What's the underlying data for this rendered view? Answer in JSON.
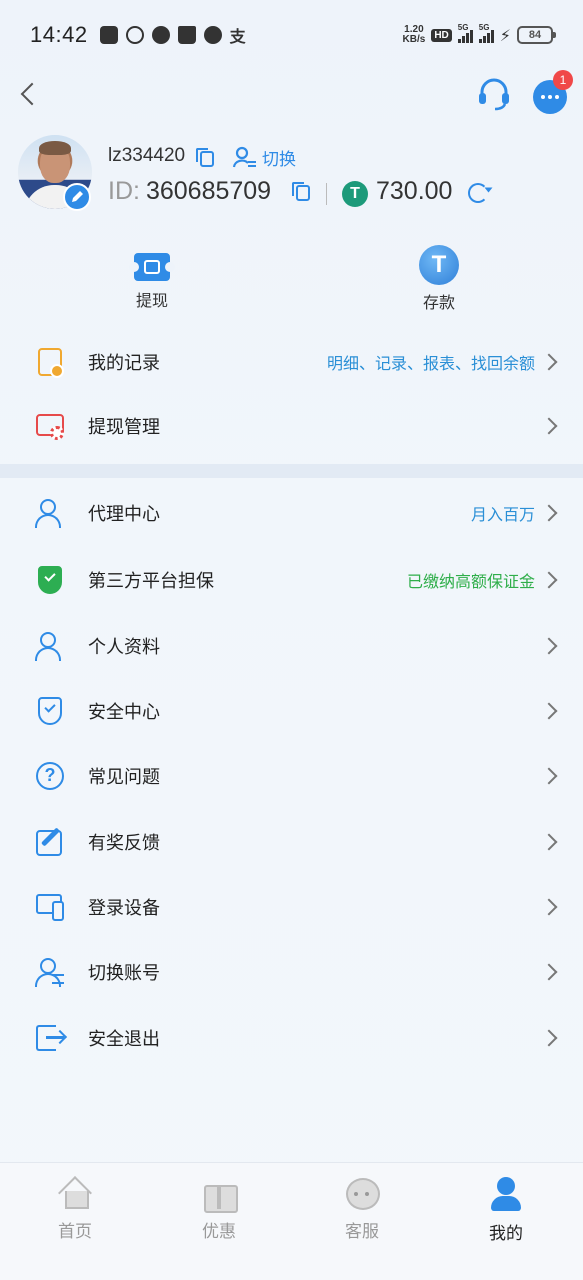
{
  "status_bar": {
    "time": "14:42",
    "net_speed_value": "1.20",
    "net_speed_unit": "KB/s",
    "hd_label": "HD",
    "sim1_label": "5G",
    "sim2_label": "5G",
    "battery": "84",
    "notif_icons": [
      "mail-icon",
      "hotspot-icon",
      "telegram-icon",
      "crown-icon",
      "weibo-icon",
      "alipay-icon"
    ],
    "alipay_glyph": "支"
  },
  "header": {
    "message_badge_count": "1"
  },
  "profile": {
    "username": "lz334420",
    "switch_label": "切换",
    "id_prefix": "ID:",
    "id_value": "360685709",
    "currency_glyph": "T",
    "balance": "730.00"
  },
  "actions": [
    {
      "label": "提现",
      "icon": "ticket-icon"
    },
    {
      "label": "存款",
      "icon": "tether-icon"
    }
  ],
  "menu_top": [
    {
      "label": "我的记录",
      "extra": "明细、记录、报表、找回余额",
      "extra_color": "#2a8fd6",
      "icon": "records-icon"
    },
    {
      "label": "提现管理",
      "extra": "",
      "icon": "withdraw-card-icon"
    }
  ],
  "menu_main": [
    {
      "label": "代理中心",
      "extra": "月入百万",
      "extra_color": "#2a8fd6",
      "icon": "agent-icon"
    },
    {
      "label": "第三方平台担保",
      "extra": "已缴纳高额保证金",
      "extra_color": "#2fae4a",
      "icon": "guarantee-shield-icon"
    },
    {
      "label": "个人资料",
      "extra": "",
      "icon": "profile-icon"
    },
    {
      "label": "安全中心",
      "extra": "",
      "icon": "security-shield-icon"
    },
    {
      "label": "常见问题",
      "extra": "",
      "icon": "question-icon"
    },
    {
      "label": "有奖反馈",
      "extra": "",
      "icon": "feedback-edit-icon"
    },
    {
      "label": "登录设备",
      "extra": "",
      "icon": "devices-icon"
    },
    {
      "label": "切换账号",
      "extra": "",
      "icon": "switch-account-icon"
    },
    {
      "label": "安全退出",
      "extra": "",
      "icon": "logout-icon"
    }
  ],
  "tabs": [
    {
      "label": "首页",
      "active": false
    },
    {
      "label": "优惠",
      "active": false
    },
    {
      "label": "客服",
      "active": false
    },
    {
      "label": "我的",
      "active": true
    }
  ],
  "colors": {
    "accent": "#2f8be6",
    "link_blue": "#2a8fd6",
    "green": "#2fae4a",
    "badge_red": "#f04848"
  }
}
